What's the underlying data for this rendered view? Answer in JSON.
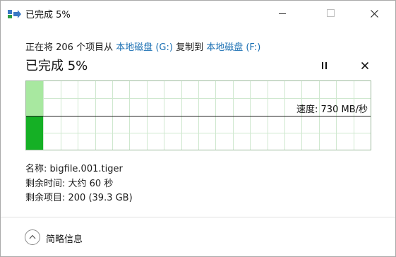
{
  "window": {
    "title": "已完成 5%"
  },
  "copy": {
    "desc_prefix": "正在将 206 个项目从 ",
    "source": "本地磁盘 (G:)",
    "desc_middle": " 复制到 ",
    "destination": "本地磁盘 (F:)",
    "status": "已完成 5%",
    "percent_complete": 5,
    "speed_label": "速度: 730 MB/秒"
  },
  "details": {
    "name": "名称: bigfile.001.tiger",
    "time_remaining": "剩余时间: 大约 60 秒",
    "items_remaining": "剩余项目: 200 (39.3 GB)"
  },
  "footer": {
    "fewer_details_label": "简略信息"
  },
  "colors": {
    "progress_light": "#a8e8a0",
    "progress_dark": "#15b025",
    "grid": "#cfe8cf",
    "link": "#1a6fb3"
  },
  "icons": {
    "app": "copy-arrow-icon",
    "pause": "pause-icon",
    "cancel": "close-icon",
    "collapse": "chevron-up-icon"
  }
}
